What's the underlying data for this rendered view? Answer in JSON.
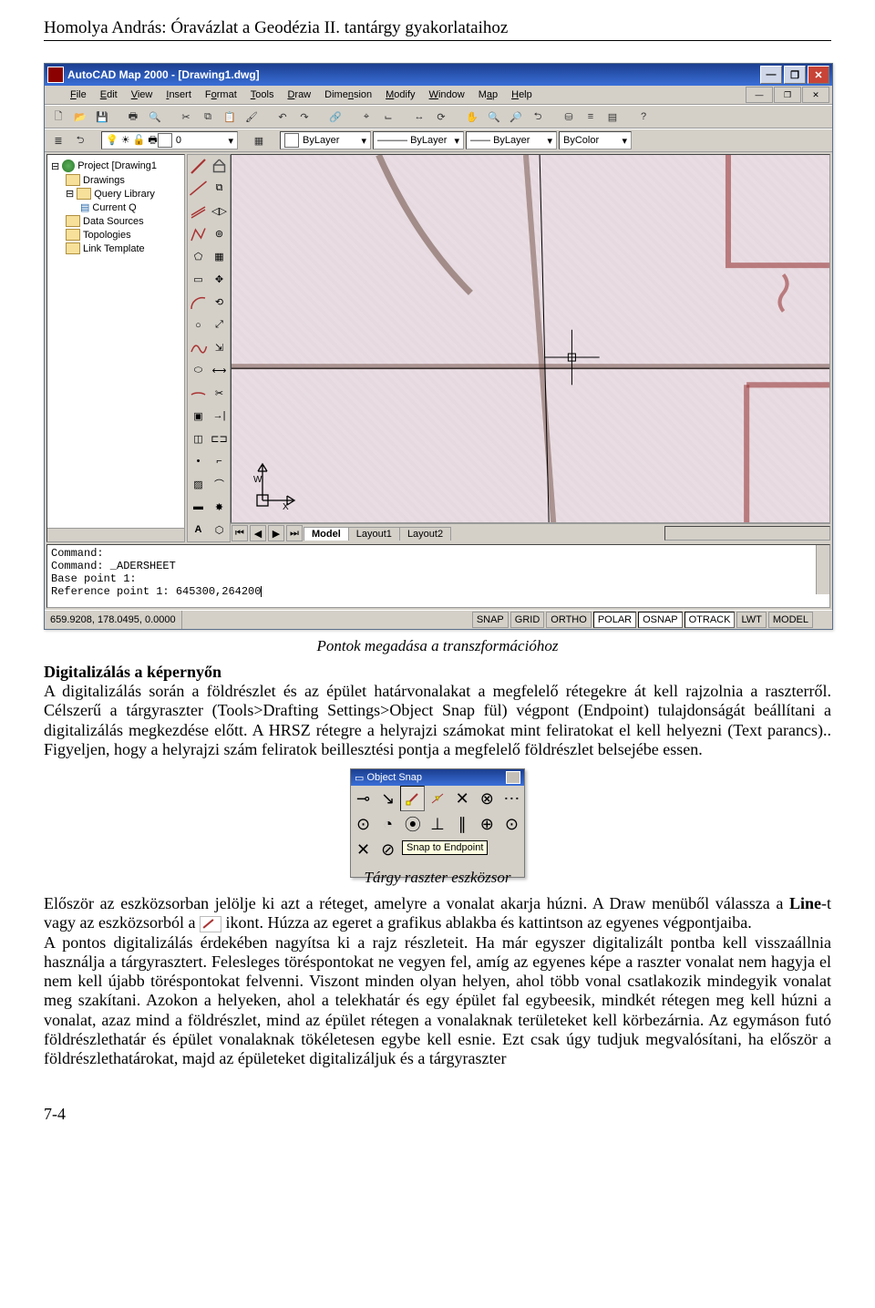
{
  "header": "Homolya András: Óravázlat a Geodézia II. tantárgy gyakorlataihoz",
  "app": {
    "title": "AutoCAD Map 2000 - [Drawing1.dwg]",
    "menus": [
      "File",
      "Edit",
      "View",
      "Insert",
      "Format",
      "Tools",
      "Draw",
      "Dimension",
      "Modify",
      "Window",
      "Map",
      "Help"
    ],
    "layer_combo": "0",
    "color_combo": "ByLayer",
    "linetype_combo": "ByLayer",
    "lineweight_combo": "ByLayer",
    "plotstyle_combo": "ByColor",
    "tree": {
      "root": "Project [Drawing1",
      "items": [
        "Drawings",
        "Query Library",
        "Current Q",
        "Data Sources",
        "Topologies",
        "Link Template"
      ],
      "sub_query": "Current Q"
    },
    "tabs": {
      "active": "Model",
      "others": [
        "Layout1",
        "Layout2"
      ]
    },
    "cmd": {
      "l1": "Command:",
      "l2": "Command: _ADERSHEET",
      "l3": "Base point 1:",
      "l4_pre": "Reference point 1: ",
      "l4_val": "645300,264200"
    },
    "status": {
      "coords": "659.9208, 178.0495, 0.0000",
      "btns": [
        "SNAP",
        "GRID",
        "ORTHO",
        "POLAR",
        "OSNAP",
        "OTRACK",
        "LWT",
        "MODEL"
      ],
      "on": [
        "POLAR",
        "OSNAP",
        "OTRACK"
      ]
    }
  },
  "caption1": "Pontok megadása a transzformációhoz",
  "sec1_heading": "Digitalizálás a képernyőn",
  "sec1_body": "A digitalizálás során a földrészlet és az épület határvonalakat a megfelelő rétegekre át kell rajzolnia a raszterről. Célszerű a tárgyraszter (Tools>Drafting Settings>Object Snap fül) végpont (Endpoint) tulajdonságát beállítani a digitalizálás megkezdése előtt. A HRSZ rétegre a helyrajzi számokat mint feliratokat el kell helyezni (Text parancs).. Figyeljen, hogy a helyrajzi szám feliratok beillesztési pontja a megfelelő földrészlet belsejébe essen.",
  "osnap": {
    "title": "Object Snap",
    "tooltip": "Snap to Endpoint"
  },
  "caption2": "Tárgy raszter eszközsor",
  "body2a": "Először az eszközsorban jelölje ki azt a réteget, amelyre a vonalat akarja húzni. A Draw menüből válassza a ",
  "body2b_bold": "Line",
  "body2c": "-t vagy az eszközsorból a ",
  "body2d": " ikont. Húzza az egeret a grafikus ablakba és kattintson az egyenes végpontjaiba.",
  "body3": "A pontos digitalizálás érdekében nagyítsa ki a rajz részleteit. Ha már egyszer digitalizált pontba kell visszaállnia használja a tárgyrasztert. Felesleges töréspontokat ne vegyen fel, amíg az egyenes képe a raszter vonalat nem hagyja el nem kell újabb töréspontokat felvenni. Viszont minden olyan helyen, ahol több vonal csatlakozik mindegyik vonalat meg szakítani. Azokon a helyeken, ahol a telekhatár és egy épület fal egybeesik, mindkét rétegen meg kell húzni a vonalat, azaz mind a földrészlet, mind az épület rétegen a vonalaknak területeket kell körbezárnia. Az egymáson futó földrészlethatár és épület vonalaknak tökéletesen egybe kell esnie. Ezt csak úgy tudjuk megvalósítani, ha először a földrészlethatárokat, majd az épületeket digitalizáljuk és a tárgyraszter",
  "page_num": "7-4"
}
